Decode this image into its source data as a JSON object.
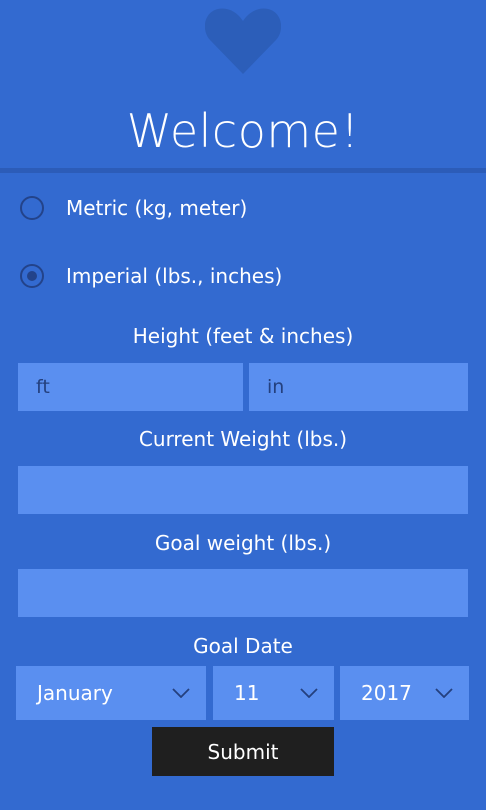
{
  "header": {
    "icon": "heart-icon",
    "title": "Welcome!"
  },
  "units": {
    "options": [
      {
        "label": "Metric (kg, meter)",
        "selected": false
      },
      {
        "label": "Imperial (lbs., inches)",
        "selected": true
      }
    ]
  },
  "height": {
    "label": "Height (feet & inches)",
    "feet_placeholder": "ft",
    "inches_placeholder": "in",
    "feet_value": "",
    "inches_value": ""
  },
  "current_weight": {
    "label": "Current Weight (lbs.)",
    "value": ""
  },
  "goal_weight": {
    "label": "Goal weight (lbs.)",
    "value": ""
  },
  "goal_date": {
    "label": "Goal Date",
    "month": "January",
    "day": "11",
    "year": "2017",
    "chevron_icon": "chevron-down-icon"
  },
  "submit_label": "Submit",
  "colors": {
    "background": "#336ad0",
    "field": "#5a8ff0",
    "radio": "#23438a",
    "button": "#1f1f1f"
  }
}
